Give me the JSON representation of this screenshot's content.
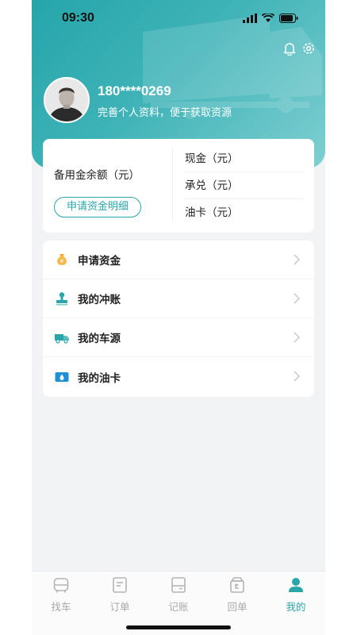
{
  "status_bar": {
    "time": "09:30"
  },
  "header": {
    "phone": "180****0269",
    "tip": "完善个人资料，便于获取资源"
  },
  "balance": {
    "label": "备用金余额（元）",
    "detail_button": "申请资金明细",
    "items": [
      "现金（元）",
      "承兑（元）",
      "油卡（元）"
    ]
  },
  "menu": {
    "items": [
      {
        "label": "申请资金",
        "icon": "money-bag-icon"
      },
      {
        "label": "我的冲账",
        "icon": "stamp-icon"
      },
      {
        "label": "我的车源",
        "icon": "truck-icon"
      },
      {
        "label": "我的油卡",
        "icon": "fuel-card-icon"
      }
    ]
  },
  "tabbar": {
    "tabs": [
      {
        "label": "找车",
        "icon": "car-icon"
      },
      {
        "label": "订单",
        "icon": "order-icon"
      },
      {
        "label": "记账",
        "icon": "ledger-icon"
      },
      {
        "label": "回单",
        "icon": "receipt-icon"
      },
      {
        "label": "我的",
        "icon": "person-icon",
        "active": true
      }
    ]
  },
  "colors": {
    "accent": "#2aa6aa",
    "header_start": "#25a5aa",
    "header_end": "#7fcfd1",
    "inactive": "#a8a8a8"
  }
}
